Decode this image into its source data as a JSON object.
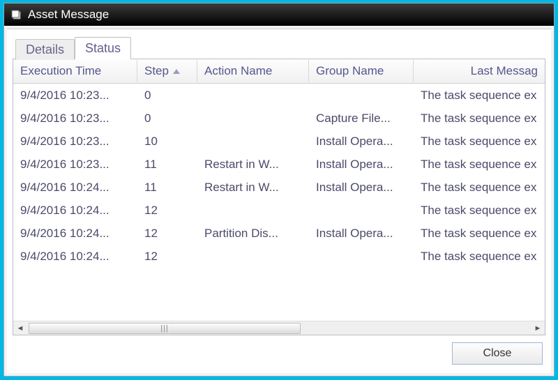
{
  "window": {
    "title": "Asset Message"
  },
  "tabs": {
    "details": "Details",
    "status": "Status"
  },
  "columns": {
    "execution_time": "Execution Time",
    "step": "Step",
    "action_name": "Action Name",
    "group_name": "Group Name",
    "last_message": "Last Messag"
  },
  "rows": [
    {
      "time": "9/4/2016 10:23...",
      "step": "0",
      "action": "",
      "group": "",
      "msg": "The task sequence ex"
    },
    {
      "time": "9/4/2016 10:23...",
      "step": "0",
      "action": "",
      "group": "Capture File...",
      "msg": "The task sequence ex"
    },
    {
      "time": "9/4/2016 10:23...",
      "step": "10",
      "action": "",
      "group": "Install Opera...",
      "msg": "The task sequence ex"
    },
    {
      "time": "9/4/2016 10:23...",
      "step": "11",
      "action": "Restart in W...",
      "group": "Install Opera...",
      "msg": "The task sequence ex"
    },
    {
      "time": "9/4/2016 10:24...",
      "step": "11",
      "action": "Restart in W...",
      "group": "Install Opera...",
      "msg": "The task sequence ex"
    },
    {
      "time": "9/4/2016 10:24...",
      "step": "12",
      "action": "",
      "group": "",
      "msg": "The task sequence ex"
    },
    {
      "time": "9/4/2016 10:24...",
      "step": "12",
      "action": "Partition Dis...",
      "group": "Install Opera...",
      "msg": "The task sequence ex"
    },
    {
      "time": "9/4/2016 10:24...",
      "step": "12",
      "action": "",
      "group": "",
      "msg": "The task sequence ex"
    }
  ],
  "buttons": {
    "close": "Close"
  },
  "scrollbar": {
    "thumb_label": "|||"
  }
}
